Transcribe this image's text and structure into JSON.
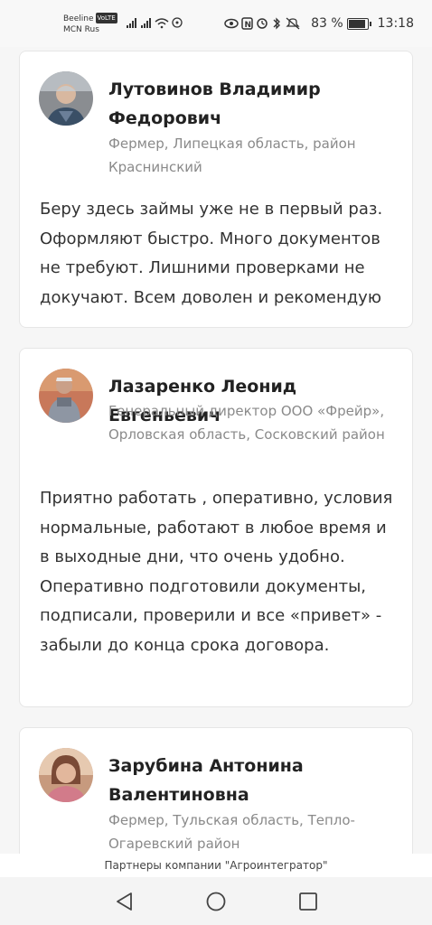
{
  "status_bar": {
    "carrier_line1": "Beeline",
    "volte_badge": "VoLTE",
    "carrier_line2": "MCN Rus",
    "battery": "83 %",
    "battery_level": 0.83,
    "time": "13:18",
    "icons": [
      "signal-icon",
      "signal-icon",
      "wifi-icon",
      "hotspot-icon",
      "eye-icon",
      "nfc-icon",
      "alarm-icon",
      "bluetooth-icon",
      "mute-icon",
      "battery-icon"
    ]
  },
  "reviews": [
    {
      "name": "Лутовинов Владимир Федорович",
      "role": "Фермер, Липецкая область, район Краснинский",
      "text": "Беру здесь займы уже не в первый раз. Оформляют быстро. Много документов не требуют. Лишними проверками не докучают. Всем доволен и рекомендую"
    },
    {
      "name": "Лазаренко Леонид Евгеньевич",
      "role": "Генеральный директор ООО «Фрейр», Орловская область, Сосковский район",
      "text": "Приятно работать , оперативно, условия нормальные, работают в любое время и в выходные дни, что очень удобно. Оперативно подготовили документы, подписали, проверили и все «привет» - забыли до конца срока договора."
    },
    {
      "name": "Зарубина Антонина Валентиновна",
      "role": "Фермер, Тульская область, Тепло-Огаревский район",
      "text": ""
    }
  ],
  "footer_note": "Партнеры компании \"Агроинтегратор\"",
  "nav": {
    "icons": [
      "back-icon",
      "home-icon",
      "recents-icon"
    ]
  }
}
